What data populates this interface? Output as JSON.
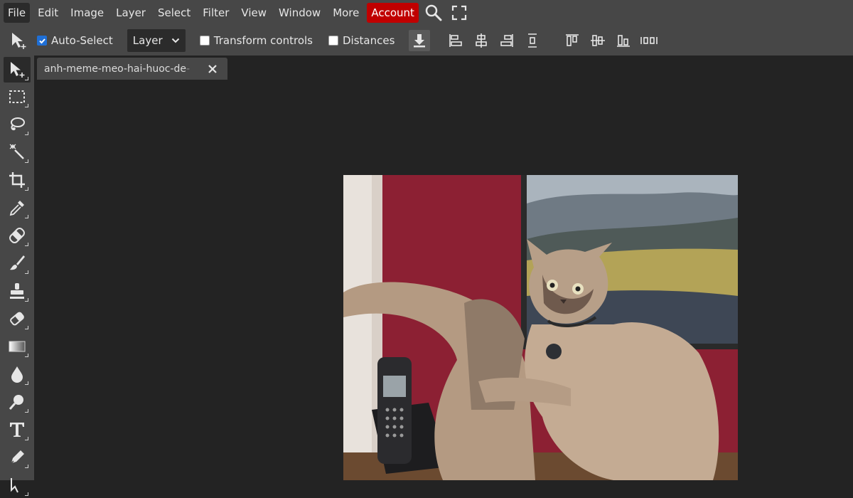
{
  "menubar": {
    "items": [
      "File",
      "Edit",
      "Image",
      "Layer",
      "Select",
      "Filter",
      "View",
      "Window",
      "More"
    ],
    "account": "Account",
    "search_icon": "search-icon",
    "fullscreen_icon": "fullscreen-icon"
  },
  "options": {
    "auto_select": {
      "label": "Auto-Select",
      "checked": true
    },
    "target": "Layer",
    "transform_controls": {
      "label": "Transform controls",
      "checked": false
    },
    "distances": {
      "label": "Distances",
      "checked": false
    }
  },
  "document": {
    "tab_title": "anh-meme-meo-hai-huoc-de",
    "tab_fade": "-"
  },
  "toolbar": {
    "tools": [
      "move-tool-icon",
      "marquee-tool-icon",
      "lasso-tool-icon",
      "magic-wand-icon",
      "crop-tool-icon",
      "eyedropper-icon",
      "healing-brush-icon",
      "brush-icon",
      "clone-stamp-icon",
      "eraser-icon",
      "gradient-icon",
      "blur-icon",
      "dodge-icon",
      "type-tool-icon",
      "pen-tool-icon"
    ]
  },
  "colors": {
    "menubar_bg": "#474747",
    "workspace_bg": "#232323",
    "account_accent": "#c00000",
    "checkbox_blue": "#1f6fd6"
  }
}
